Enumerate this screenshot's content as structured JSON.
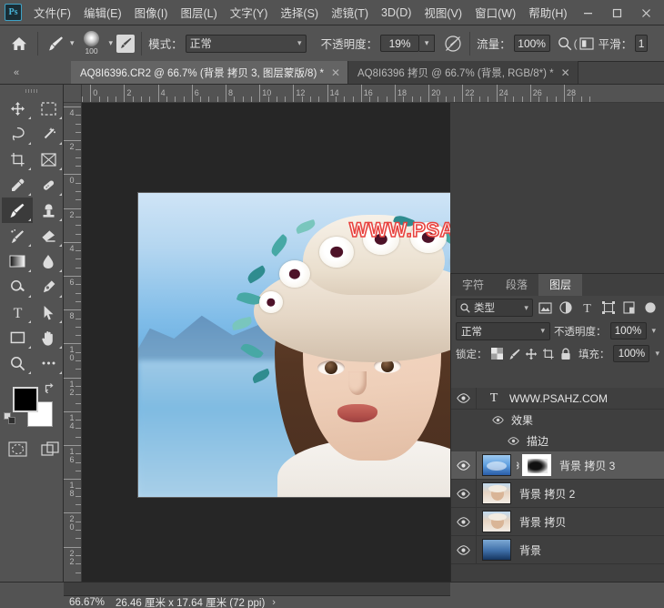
{
  "app": {
    "logo_text": "Ps",
    "title": "Adobe Photoshop"
  },
  "menubar": {
    "items": [
      {
        "label": "文件(F)"
      },
      {
        "label": "编辑(E)"
      },
      {
        "label": "图像(I)"
      },
      {
        "label": "图层(L)"
      },
      {
        "label": "文字(Y)"
      },
      {
        "label": "选择(S)"
      },
      {
        "label": "滤镜(T)"
      },
      {
        "label": "3D(D)"
      },
      {
        "label": "视图(V)"
      },
      {
        "label": "窗口(W)"
      },
      {
        "label": "帮助(H)"
      }
    ],
    "window_controls": {
      "minimize": "—",
      "maximize": "□",
      "close": "✕"
    }
  },
  "options_bar": {
    "home_icon": "home-icon",
    "brush_icon": "brush-icon",
    "brush_size": "100",
    "tablet_pressure_icon": "tablet-pressure-icon",
    "mode_label": "模式：",
    "mode_value": "正常",
    "opacity_label": "不透明度：",
    "opacity_value": "19%",
    "airbrush_icon": "airbrush-icon",
    "flow_label": "流量：",
    "flow_value": "100%",
    "smooth_search_icon": "smoothing-icon",
    "smoothing_label": "平滑：",
    "smoothing_value": "1"
  },
  "tabbar": {
    "collapse_icon": "«",
    "tabs": [
      {
        "title": "AQ8I6396.CR2 @ 66.7% (背景 拷贝 3, 图层蒙版/8) *",
        "active": true,
        "close": "✕"
      },
      {
        "title": "AQ8I6396 拷贝 @ 66.7% (背景, RGB/8*) *",
        "active": false,
        "close": "✕"
      }
    ]
  },
  "toolbar": {
    "tools": [
      {
        "name": "move-tool",
        "active": false
      },
      {
        "name": "marquee-tool",
        "active": false
      },
      {
        "name": "lasso-tool",
        "active": false
      },
      {
        "name": "magic-wand-tool",
        "active": false
      },
      {
        "name": "crop-tool",
        "active": false
      },
      {
        "name": "frame-tool",
        "active": false
      },
      {
        "name": "eyedropper-tool",
        "active": false
      },
      {
        "name": "healing-brush-tool",
        "active": false
      },
      {
        "name": "brush-tool",
        "active": true
      },
      {
        "name": "clone-stamp-tool",
        "active": false
      },
      {
        "name": "history-brush-tool",
        "active": false
      },
      {
        "name": "eraser-tool",
        "active": false
      },
      {
        "name": "gradient-tool",
        "active": false
      },
      {
        "name": "blur-tool",
        "active": false
      },
      {
        "name": "dodge-tool",
        "active": false
      },
      {
        "name": "pen-tool",
        "active": false
      },
      {
        "name": "type-tool",
        "active": false
      },
      {
        "name": "path-selection-tool",
        "active": false
      },
      {
        "name": "shape-tool",
        "active": false
      },
      {
        "name": "hand-tool",
        "active": false
      },
      {
        "name": "zoom-tool",
        "active": false
      },
      {
        "name": "more-tools",
        "active": false
      }
    ],
    "foreground_color": "#000000",
    "background_color": "#ffffff",
    "swap_icon": "swap-colors-icon",
    "default_colors_icon": "default-colors-icon",
    "quickmask_icon": "quick-mask-icon",
    "screenmode_icon": "screen-mode-icon"
  },
  "rulers": {
    "horizontal_labels": [
      "2",
      "0",
      "2",
      "4",
      "6",
      "8",
      "10",
      "12",
      "14",
      "16",
      "18",
      "20",
      "22",
      "24",
      "26",
      "28"
    ],
    "vertical_labels": [
      "4",
      "2",
      "0",
      "2",
      "4",
      "6",
      "8",
      "10",
      "12",
      "14",
      "16",
      "18",
      "20",
      "22"
    ],
    "unit": "厘米"
  },
  "canvas": {
    "watermark_text": "WWW.PSAHZ.COM",
    "watermark_color": "#e8433f",
    "background_color": "#262626"
  },
  "layers_panel": {
    "tabs": [
      {
        "label": "字符",
        "active": false
      },
      {
        "label": "段落",
        "active": false
      },
      {
        "label": "图层",
        "active": true
      }
    ],
    "filter": {
      "search_icon": "search-icon",
      "kind_label": "类型",
      "icons": [
        "pixel-filter-icon",
        "adjustment-filter-icon",
        "type-filter-icon",
        "shape-filter-icon",
        "smart-object-filter-icon",
        "filter-toggle-icon"
      ]
    },
    "blend_mode_label": "",
    "blend_mode_value": "正常",
    "opacity_label": "不透明度：",
    "opacity_value": "100%",
    "lock_label": "锁定：",
    "lock_icons": [
      "lock-transparent-pixels-icon",
      "lock-image-pixels-icon",
      "lock-position-icon",
      "lock-artboard-nesting-icon",
      "lock-all-icon"
    ],
    "fill_label": "填充：",
    "fill_value": "100%",
    "layers": [
      {
        "name": "WWW.PSAHZ.COM",
        "type": "text",
        "glyph": "T",
        "visible": true,
        "selected": false,
        "effects_group_label": "效果",
        "effects": [
          "描边"
        ]
      },
      {
        "name": "背景 拷贝 3",
        "type": "image-with-mask",
        "visible": true,
        "selected": true,
        "link_icon": "mask-link-icon"
      },
      {
        "name": "背景 拷贝 2",
        "type": "image",
        "visible": true,
        "selected": false
      },
      {
        "name": "背景 拷贝",
        "type": "image",
        "visible": true,
        "selected": false
      },
      {
        "name": "背景",
        "type": "image",
        "visible": true,
        "selected": false
      }
    ]
  },
  "statusbar": {
    "zoom": "66.67%",
    "dimensions": "26.46 厘米 x 17.64 厘米 (72 ppi)",
    "expand_icon": "›"
  }
}
